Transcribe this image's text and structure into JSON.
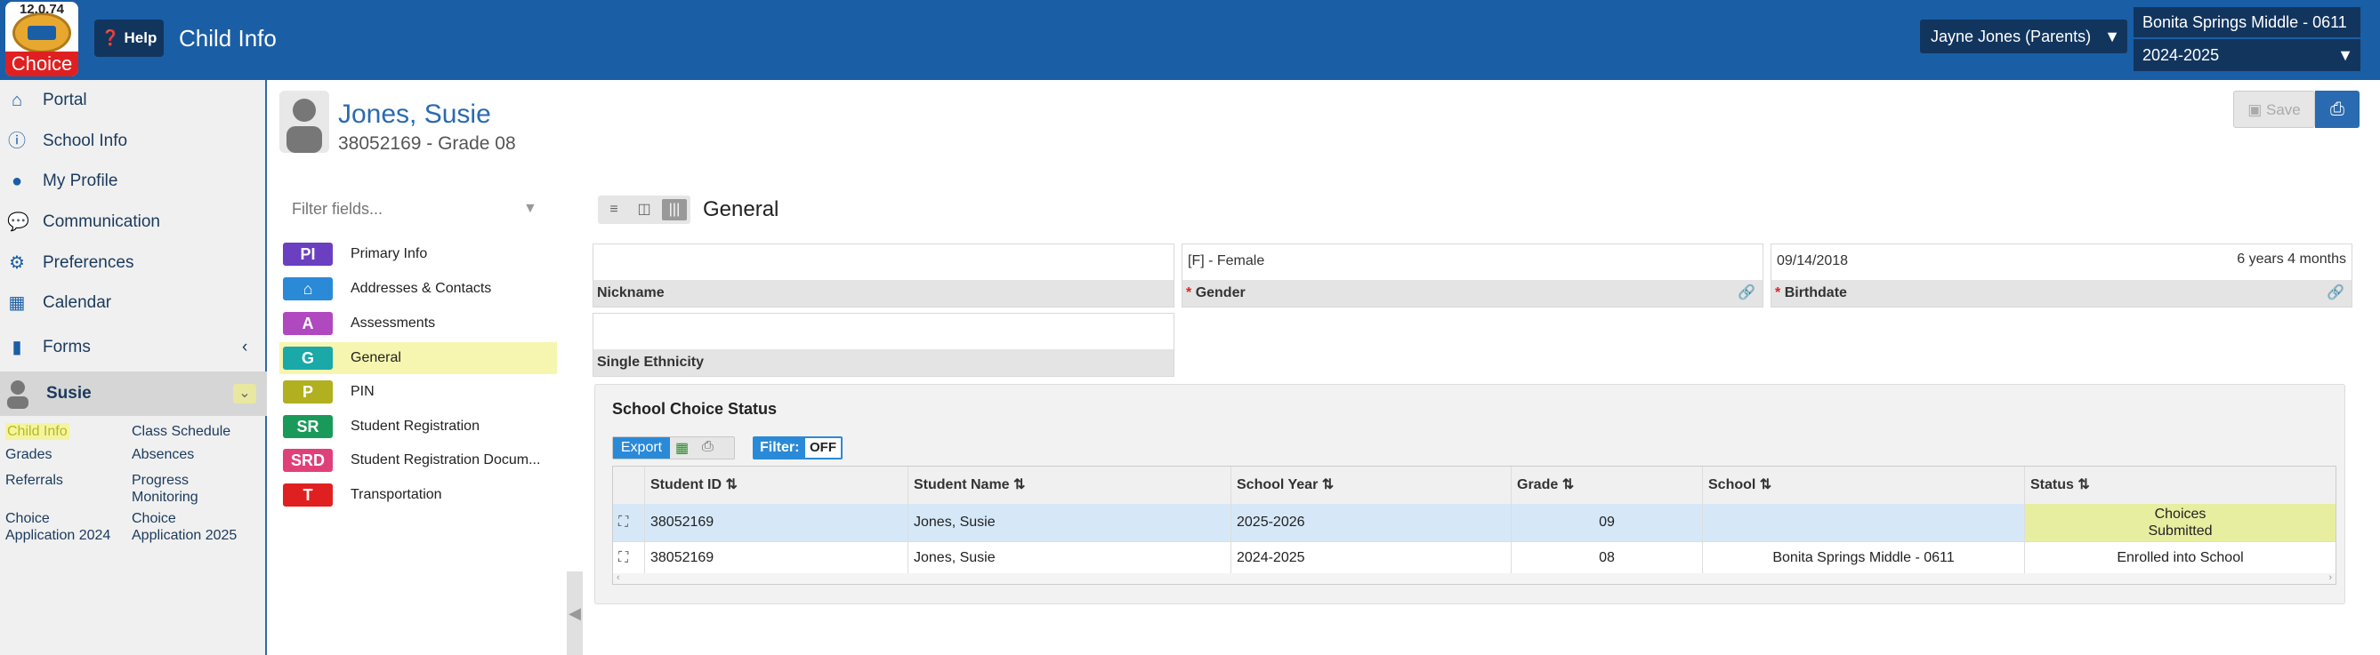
{
  "app": {
    "version": "12.0.74",
    "brand": "Choice",
    "help_label": "Help",
    "title": "Child Info"
  },
  "top": {
    "user": "Jayne Jones (Parents)",
    "school": "Bonita Springs Middle - 0611",
    "year": "2024-2025"
  },
  "sidebar": {
    "items": [
      {
        "label": "Portal",
        "icon": "home-icon"
      },
      {
        "label": "School Info",
        "icon": "info-icon"
      },
      {
        "label": "My Profile",
        "icon": "user-icon"
      },
      {
        "label": "Communication",
        "icon": "chat-icon"
      },
      {
        "label": "Preferences",
        "icon": "gear-icon"
      },
      {
        "label": "Calendar",
        "icon": "calendar-icon"
      },
      {
        "label": "Forms",
        "icon": "document-icon"
      }
    ],
    "student": "Susie",
    "sublinks": [
      "Child Info",
      "Class Schedule",
      "Grades",
      "Absences",
      "Referrals",
      "Progress Monitoring",
      "Choice Application 2024",
      "Choice Application 2025"
    ]
  },
  "student": {
    "name": "Jones, Susie",
    "id_grade": "38052169 - Grade 08"
  },
  "toolbar": {
    "save_label": "Save"
  },
  "fields": {
    "filter_placeholder": "Filter fields...",
    "items": [
      {
        "badge": "PI",
        "label": "Primary Info",
        "color": "#6a3fc0"
      },
      {
        "badge": "⌂",
        "label": "Addresses & Contacts",
        "color": "#2a8ad8"
      },
      {
        "badge": "A",
        "label": "Assessments",
        "color": "#b048c0"
      },
      {
        "badge": "G",
        "label": "General",
        "color": "#1aa8a8"
      },
      {
        "badge": "P",
        "label": "PIN",
        "color": "#b0b020"
      },
      {
        "badge": "SR",
        "label": "Student Registration",
        "color": "#1a9a5a"
      },
      {
        "badge": "SRD",
        "label": "Student Registration Docum...",
        "color": "#e0407a"
      },
      {
        "badge": "T",
        "label": "Transportation",
        "color": "#e02020"
      }
    ]
  },
  "section": {
    "title": "General"
  },
  "general": {
    "nickname_label": "Nickname",
    "nickname_value": "",
    "gender_label": "Gender",
    "gender_value": "[F] - Female",
    "birthdate_label": "Birthdate",
    "birthdate_value": "09/14/2018",
    "age": "6 years 4 months",
    "ethnicity_label": "Single Ethnicity",
    "ethnicity_value": ""
  },
  "school_choice": {
    "title": "School Choice Status",
    "export_label": "Export",
    "filter_label": "Filter:",
    "filter_state": "OFF",
    "columns": [
      "Student ID",
      "Student Name",
      "School Year",
      "Grade",
      "School",
      "Status"
    ],
    "rows": [
      {
        "student_id": "38052169",
        "name": "Jones, Susie",
        "year": "2025-2026",
        "grade": "09",
        "school": "",
        "status": "Choices Submitted"
      },
      {
        "student_id": "38052169",
        "name": "Jones, Susie",
        "year": "2024-2025",
        "grade": "08",
        "school": "Bonita Springs Middle - 0611",
        "status": "Enrolled into School"
      }
    ]
  }
}
